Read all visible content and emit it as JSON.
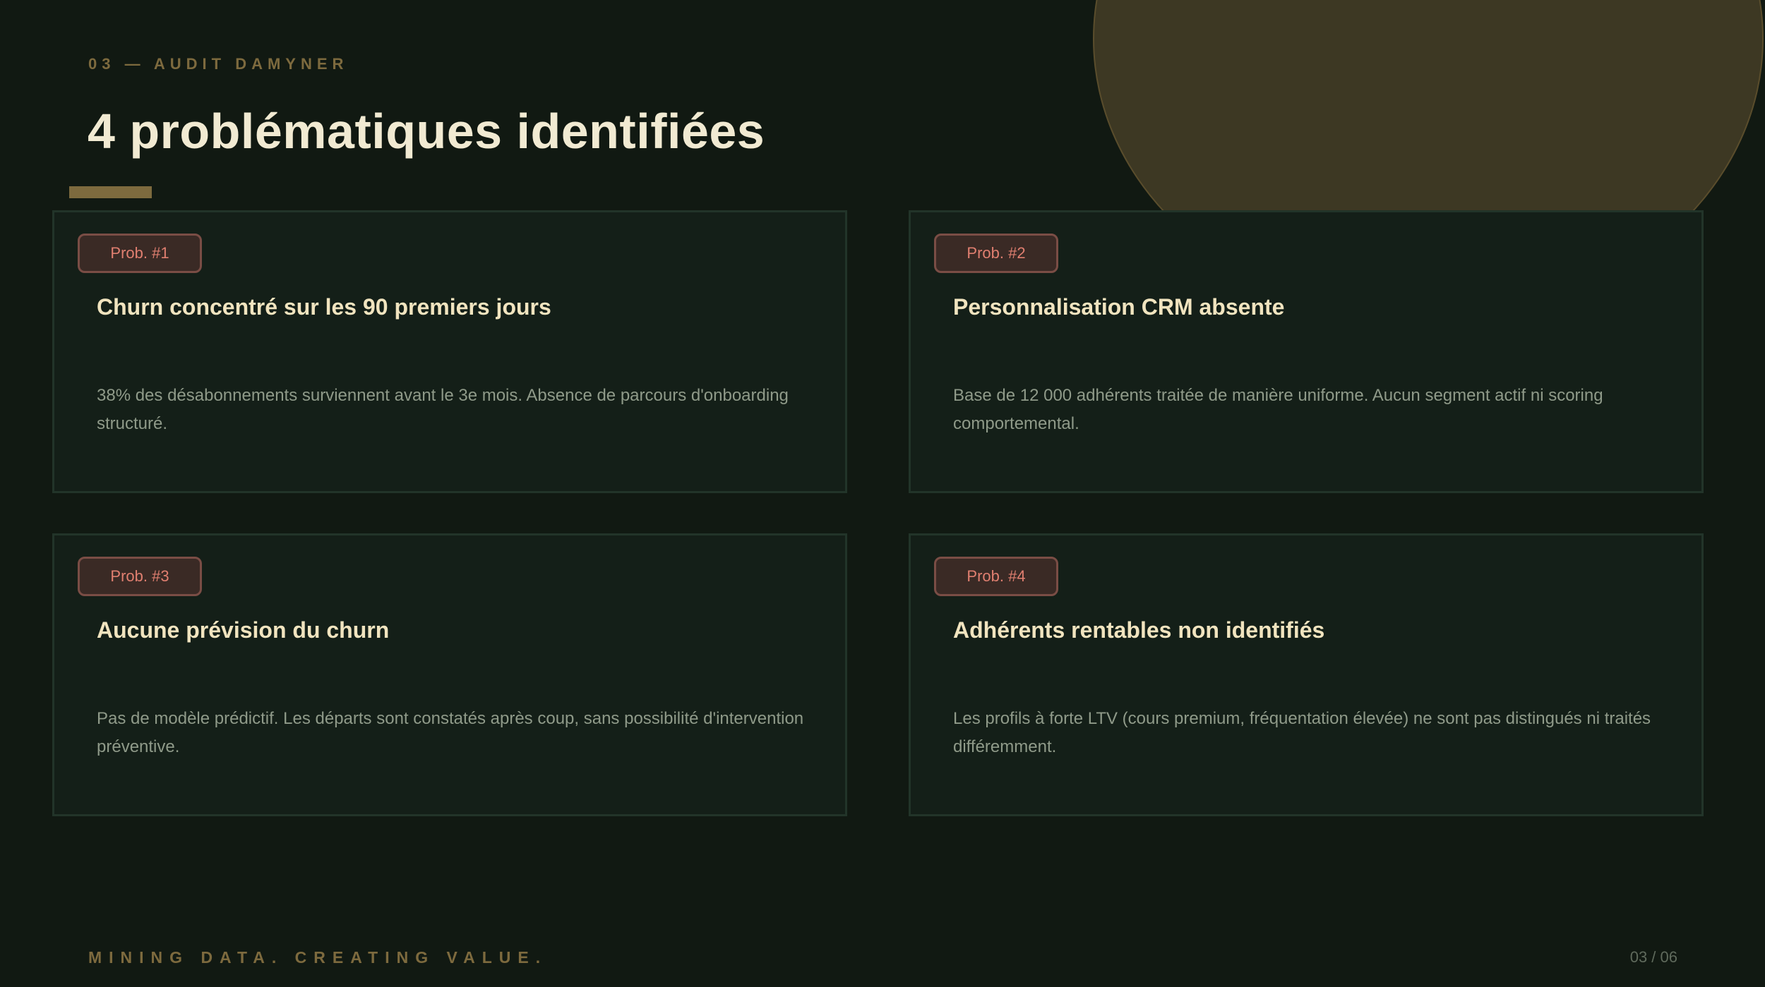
{
  "slide": {
    "eyebrow": "03 — AUDIT DAMYNER",
    "title": "4 problématiques identifiées"
  },
  "problems": [
    {
      "badge": "Prob. #1",
      "title": "Churn concentré sur les 90 premiers jours",
      "description": "38% des désabonnements surviennent avant le 3e mois. Absence de parcours d'onboarding structuré."
    },
    {
      "badge": "Prob. #2",
      "title": "Personnalisation CRM absente",
      "description": "Base de 12 000 adhérents traitée de manière uniforme. Aucun segment actif ni scoring comportemental."
    },
    {
      "badge": "Prob. #3",
      "title": "Aucune prévision du churn",
      "description": "Pas de modèle prédictif. Les départs sont constatés après coup, sans possibilité d'intervention préventive."
    },
    {
      "badge": "Prob. #4",
      "title": "Adhérents rentables non identifiés",
      "description": "Les profils à forte LTV (cours premium, fréquentation élevée) ne sont pas distingués ni traités différemment."
    }
  ],
  "footer": {
    "tagline": "MINING DATA. CREATING VALUE.",
    "page_number": "03 / 06"
  },
  "colors": {
    "background": "#111912",
    "accent_gold": "#7d6a3e",
    "card_background": "#141f18",
    "card_border": "#223429",
    "badge_text": "#e07f70",
    "title_text": "#f1ead2"
  }
}
